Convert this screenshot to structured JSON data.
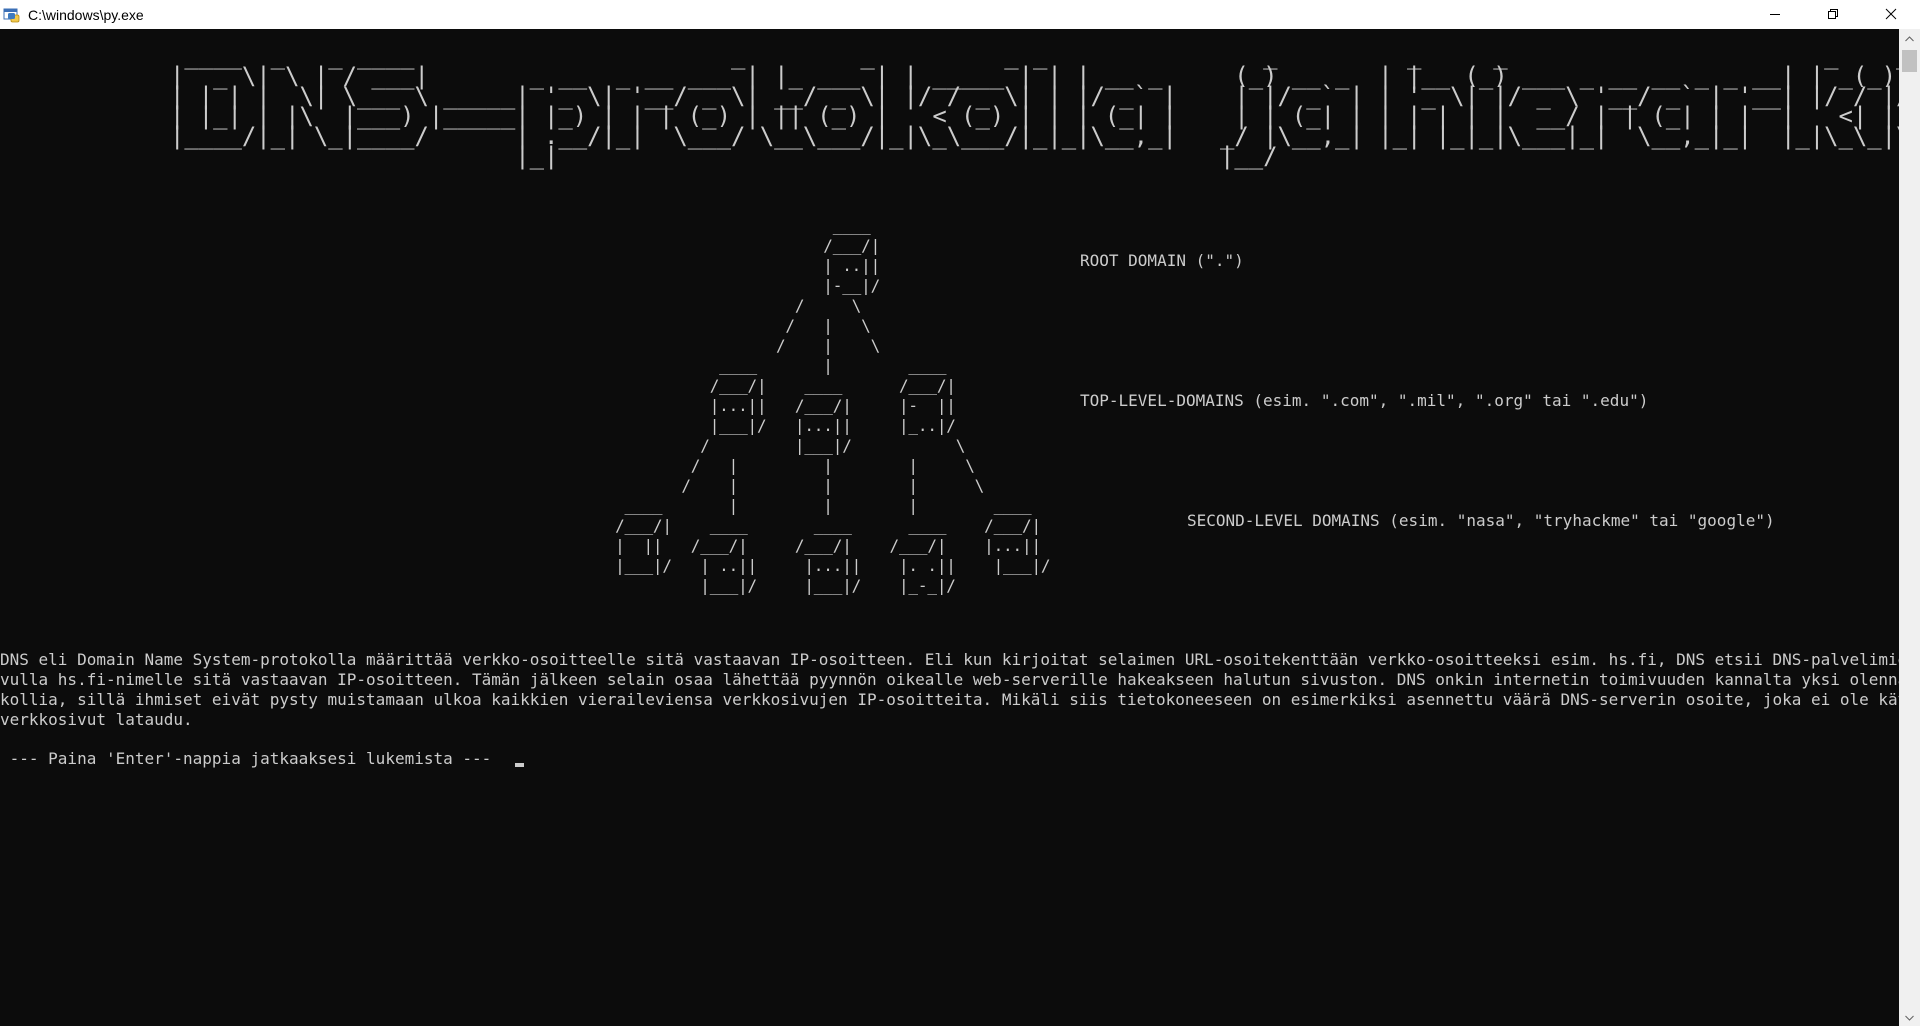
{
  "window": {
    "title": "C:\\windows\\py.exe",
    "icon": "python-app-icon"
  },
  "controls": {
    "minimize": "minimize-icon",
    "maximize": "restore-icon",
    "close": "close-icon"
  },
  "console": {
    "banner_lines": [
      " ____  _   _ ____                      _        _         _ _               _         _     _                      _    _       ",
      "|  _ \\| \\ | / ___|       _ __  _ __ ___ | |_ ___ | | _____ | | | __ _     (_) __ _  | |__ (_) ___ _ __ __ _ _ __| | _(_) __ _ ",
      "| | | |  \\| \\___ \\ _____| '_ \\| '__/ _ \\| __/ _ \\| |/ / _ \\| | |/ _` |    | |/ _` | | '_ \\| |/ _ \\ '__/ _` | '__| |/ / |/ _` |",
      "| |_| | |\\  |___) |_____| |_) | | | (_) | || (_) |   < (_) | | | (_| |    | | (_| | | | | | |  __/ | | (_| | |  |   <| | (_| |",
      "|____/|_| \\_|____/      | .__/|_|  \\___/ \\__\\___/|_|\\_\\___/|_|_|\\__,_|   _/ |\\__,_| |_| |_|_|\\___|_|  \\__,_|_|  |_|\\_\\_|\\__,_|",
      "                        |_|                                              |__/                                                  "
    ],
    "tree_lines": [
      "                                                                                        ____",
      "                                                                                       /___/|",
      "                                                                                       | ..||",
      "                                                                                       |-__|/",
      "                                                                                    /     \\",
      "                                                                                   /   |   \\",
      "                                                                                  /    |    \\",
      "                                                                            ____       |        ____",
      "                                                                           /___/|    ____      /___/|",
      "                                                                           |...||   /___/|     |-  ||",
      "                                                                           |___|/   |...||     |_..|/",
      "                                                                          /         |___|/           \\",
      "                                                                         /   |         |        |     \\",
      "                                                                        /    |         |        |      \\",
      "                                                                  ____       |         |        |        ____",
      "                                                                 /___/|    ____       ____      ____    /___/|",
      "                                                                 |  ||   /___/|     /___/|    /___/|    |...||",
      "                                                                 |___|/   | ..||     |...||    |. .||    |___|/",
      "                                                                          |___|/     |___|/    |_-_|/"
    ],
    "levels": {
      "root": "ROOT DOMAIN (\".\")",
      "tld": "TOP-LEVEL-DOMAINS (esim. \".com\", \".mil\", \".org\" tai \".edu\")",
      "sld": "SECOND-LEVEL DOMAINS (esim. \"nasa\", \"tryhackme\" tai \"google\")"
    },
    "paragraph_lines": [
      "DNS eli Domain Name System-protokolla määrittää verkko-osoitteelle sitä vastaavan IP-osoitteen. Eli kun kirjoitat selaimen URL-osoitekenttään verkko-osoitteeksi esim. hs.fi, DNS etsii DNS-palvelimien verkoston a",
      "vulla hs.fi-nimelle sitä vastaavan IP-osoitteen. Tämän jälkeen selain osaa lähettää pyynnön oikealle web-serverille hakeakseen halutun sivuston. DNS onkin internetin toimivuuden kannalta yksi olennaisimpia proto",
      "kollia, sillä ihmiset eivät pysty muistamaan ulkoa kaikkien vieraileviensa verkkosivujen IP-osoitteita. Mikäli siis tietokoneeseen on esimerkiksi asennettu väärä DNS-serverin osoite, joka ei ole käytössä, eivät",
      "verkkosivut lataudu."
    ],
    "prompt": " --- Paina 'Enter'-nappia jatkaaksesi lukemista --- "
  },
  "scrollbar": {
    "up": "scroll-up-arrow-icon",
    "down": "scroll-down-arrow-icon"
  }
}
